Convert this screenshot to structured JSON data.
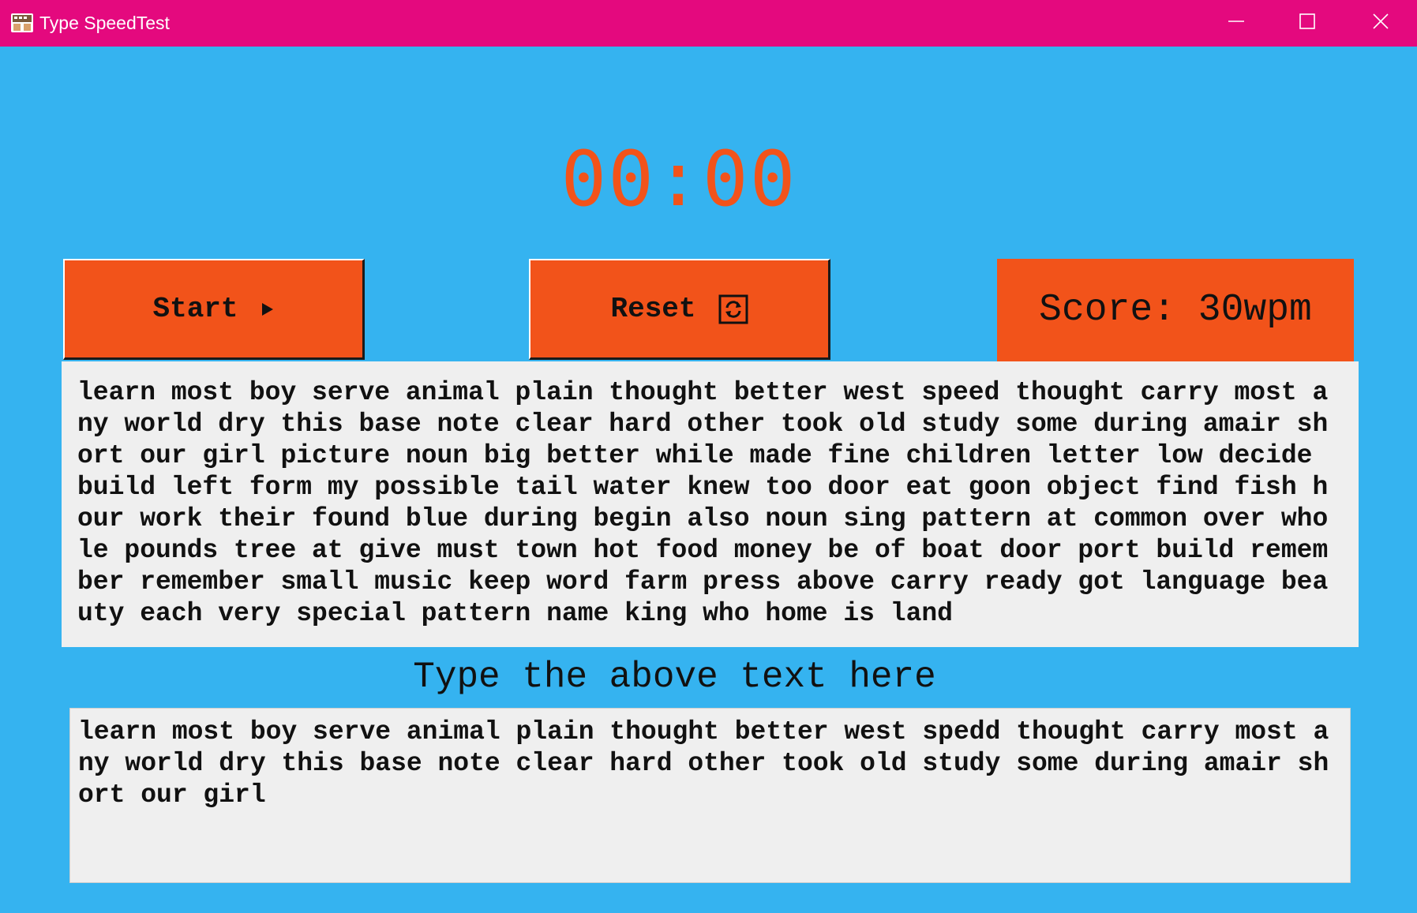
{
  "window": {
    "title": "Type SpeedTest",
    "titlebar_color": "#e4097e",
    "background_color": "#35b3f0",
    "icons": [
      "app-icon",
      "minimize-icon",
      "maximize-icon",
      "close-icon"
    ]
  },
  "timer": {
    "display": "00:00",
    "color": "#f2531a"
  },
  "controls": {
    "start_label": "Start",
    "start_icon": "play-icon",
    "reset_label": "Reset",
    "reset_icon": "refresh-icon",
    "button_color": "#f2531a"
  },
  "score": {
    "text": "Score: 30wpm"
  },
  "sample": {
    "text": "learn most boy serve animal plain thought better west speed thought carry most any world dry this base note clear hard other took old study some during amair short our girl picture noun big better while made fine children letter low decide build left form my possible tail water knew too door eat goon object find fish hour work their found blue during begin also noun sing pattern at common over whole pounds tree at give must town hot food money be of boat door port build remember remember small music keep word farm press above carry ready got language beauty each very special pattern name king who home is land"
  },
  "instruction": {
    "text": "Type the above text here"
  },
  "input": {
    "text": "learn most boy serve animal plain thought better west spedd thought carry most any world dry this base note clear hard other took old study some during amair short our girl"
  }
}
